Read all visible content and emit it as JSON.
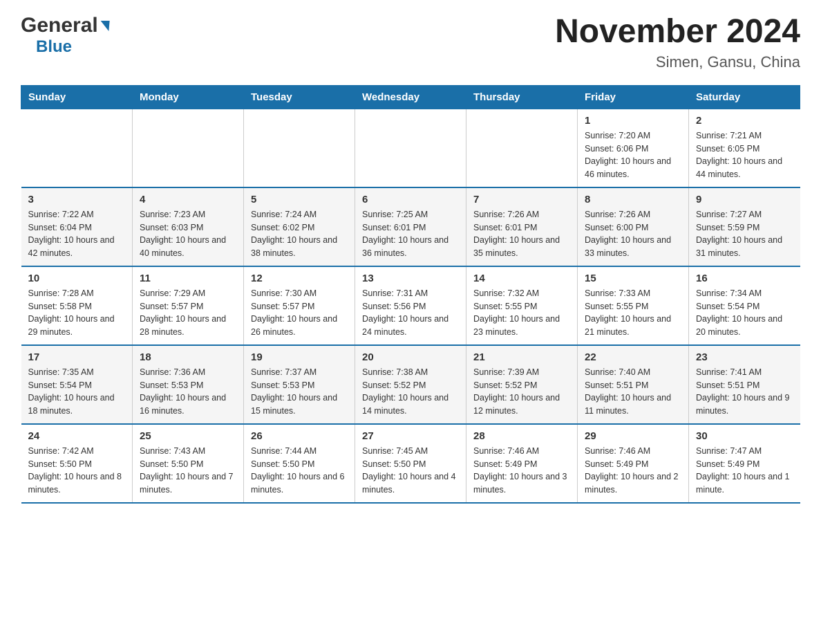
{
  "header": {
    "logo_general": "General",
    "logo_blue": "Blue",
    "title": "November 2024",
    "subtitle": "Simen, Gansu, China"
  },
  "weekdays": [
    "Sunday",
    "Monday",
    "Tuesday",
    "Wednesday",
    "Thursday",
    "Friday",
    "Saturday"
  ],
  "weeks": [
    [
      {
        "day": "",
        "info": ""
      },
      {
        "day": "",
        "info": ""
      },
      {
        "day": "",
        "info": ""
      },
      {
        "day": "",
        "info": ""
      },
      {
        "day": "",
        "info": ""
      },
      {
        "day": "1",
        "info": "Sunrise: 7:20 AM\nSunset: 6:06 PM\nDaylight: 10 hours and 46 minutes."
      },
      {
        "day": "2",
        "info": "Sunrise: 7:21 AM\nSunset: 6:05 PM\nDaylight: 10 hours and 44 minutes."
      }
    ],
    [
      {
        "day": "3",
        "info": "Sunrise: 7:22 AM\nSunset: 6:04 PM\nDaylight: 10 hours and 42 minutes."
      },
      {
        "day": "4",
        "info": "Sunrise: 7:23 AM\nSunset: 6:03 PM\nDaylight: 10 hours and 40 minutes."
      },
      {
        "day": "5",
        "info": "Sunrise: 7:24 AM\nSunset: 6:02 PM\nDaylight: 10 hours and 38 minutes."
      },
      {
        "day": "6",
        "info": "Sunrise: 7:25 AM\nSunset: 6:01 PM\nDaylight: 10 hours and 36 minutes."
      },
      {
        "day": "7",
        "info": "Sunrise: 7:26 AM\nSunset: 6:01 PM\nDaylight: 10 hours and 35 minutes."
      },
      {
        "day": "8",
        "info": "Sunrise: 7:26 AM\nSunset: 6:00 PM\nDaylight: 10 hours and 33 minutes."
      },
      {
        "day": "9",
        "info": "Sunrise: 7:27 AM\nSunset: 5:59 PM\nDaylight: 10 hours and 31 minutes."
      }
    ],
    [
      {
        "day": "10",
        "info": "Sunrise: 7:28 AM\nSunset: 5:58 PM\nDaylight: 10 hours and 29 minutes."
      },
      {
        "day": "11",
        "info": "Sunrise: 7:29 AM\nSunset: 5:57 PM\nDaylight: 10 hours and 28 minutes."
      },
      {
        "day": "12",
        "info": "Sunrise: 7:30 AM\nSunset: 5:57 PM\nDaylight: 10 hours and 26 minutes."
      },
      {
        "day": "13",
        "info": "Sunrise: 7:31 AM\nSunset: 5:56 PM\nDaylight: 10 hours and 24 minutes."
      },
      {
        "day": "14",
        "info": "Sunrise: 7:32 AM\nSunset: 5:55 PM\nDaylight: 10 hours and 23 minutes."
      },
      {
        "day": "15",
        "info": "Sunrise: 7:33 AM\nSunset: 5:55 PM\nDaylight: 10 hours and 21 minutes."
      },
      {
        "day": "16",
        "info": "Sunrise: 7:34 AM\nSunset: 5:54 PM\nDaylight: 10 hours and 20 minutes."
      }
    ],
    [
      {
        "day": "17",
        "info": "Sunrise: 7:35 AM\nSunset: 5:54 PM\nDaylight: 10 hours and 18 minutes."
      },
      {
        "day": "18",
        "info": "Sunrise: 7:36 AM\nSunset: 5:53 PM\nDaylight: 10 hours and 16 minutes."
      },
      {
        "day": "19",
        "info": "Sunrise: 7:37 AM\nSunset: 5:53 PM\nDaylight: 10 hours and 15 minutes."
      },
      {
        "day": "20",
        "info": "Sunrise: 7:38 AM\nSunset: 5:52 PM\nDaylight: 10 hours and 14 minutes."
      },
      {
        "day": "21",
        "info": "Sunrise: 7:39 AM\nSunset: 5:52 PM\nDaylight: 10 hours and 12 minutes."
      },
      {
        "day": "22",
        "info": "Sunrise: 7:40 AM\nSunset: 5:51 PM\nDaylight: 10 hours and 11 minutes."
      },
      {
        "day": "23",
        "info": "Sunrise: 7:41 AM\nSunset: 5:51 PM\nDaylight: 10 hours and 9 minutes."
      }
    ],
    [
      {
        "day": "24",
        "info": "Sunrise: 7:42 AM\nSunset: 5:50 PM\nDaylight: 10 hours and 8 minutes."
      },
      {
        "day": "25",
        "info": "Sunrise: 7:43 AM\nSunset: 5:50 PM\nDaylight: 10 hours and 7 minutes."
      },
      {
        "day": "26",
        "info": "Sunrise: 7:44 AM\nSunset: 5:50 PM\nDaylight: 10 hours and 6 minutes."
      },
      {
        "day": "27",
        "info": "Sunrise: 7:45 AM\nSunset: 5:50 PM\nDaylight: 10 hours and 4 minutes."
      },
      {
        "day": "28",
        "info": "Sunrise: 7:46 AM\nSunset: 5:49 PM\nDaylight: 10 hours and 3 minutes."
      },
      {
        "day": "29",
        "info": "Sunrise: 7:46 AM\nSunset: 5:49 PM\nDaylight: 10 hours and 2 minutes."
      },
      {
        "day": "30",
        "info": "Sunrise: 7:47 AM\nSunset: 5:49 PM\nDaylight: 10 hours and 1 minute."
      }
    ]
  ]
}
